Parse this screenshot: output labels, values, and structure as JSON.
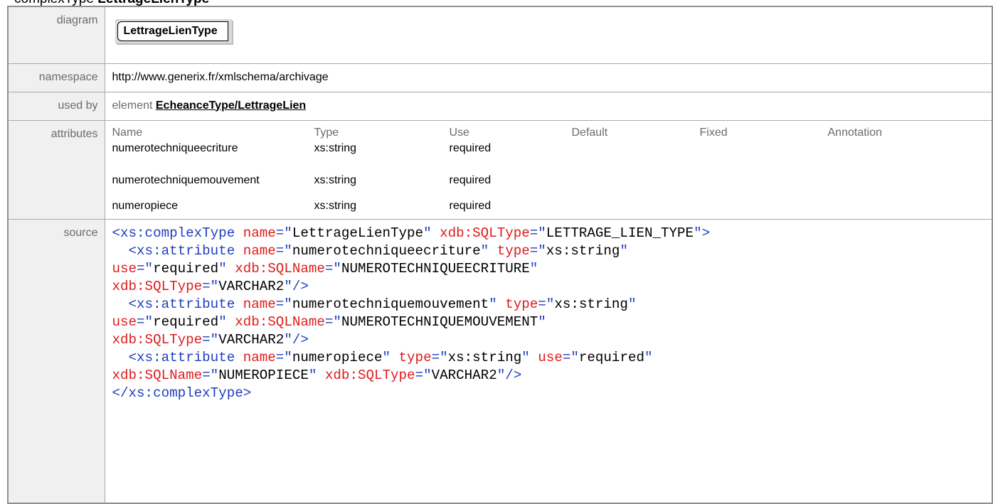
{
  "heading": {
    "kind": "complexType",
    "name": "LettrageLienType"
  },
  "diagram": {
    "label": "diagram",
    "box_text": "LettrageLienType"
  },
  "namespace": {
    "label": "namespace",
    "value": "http://www.generix.fr/xmlschema/archivage"
  },
  "used_by": {
    "label": "used by",
    "kind": "element",
    "link": "EcheanceType/LettrageLien"
  },
  "attributes": {
    "label": "attributes",
    "headers": [
      "Name",
      "Type",
      "Use",
      "Default",
      "Fixed",
      "Annotation"
    ],
    "rows": [
      {
        "name": "numerotechniqueecriture",
        "type": "xs:string",
        "use": "required"
      },
      {
        "name": "numerotechniquemouvement",
        "type": "xs:string",
        "use": "required"
      },
      {
        "name": "numeropiece",
        "type": "xs:string",
        "use": "required"
      }
    ]
  },
  "source": {
    "label": "source",
    "lines": [
      [
        [
          "k",
          "<xs:complexType"
        ],
        [
          "t",
          " "
        ],
        [
          "a",
          "name"
        ],
        [
          "k",
          "=\""
        ],
        [
          "t",
          "LettrageLienType"
        ],
        [
          "k",
          "\""
        ],
        [
          "t",
          " "
        ],
        [
          "a",
          "xdb:SQLType"
        ],
        [
          "k",
          "=\""
        ],
        [
          "t",
          "LETTRAGE_LIEN_TYPE"
        ],
        [
          "k",
          "\">"
        ]
      ],
      [
        [
          "t",
          "  "
        ],
        [
          "k",
          "<xs:attribute"
        ],
        [
          "t",
          " "
        ],
        [
          "a",
          "name"
        ],
        [
          "k",
          "=\""
        ],
        [
          "t",
          "numerotechniqueecriture"
        ],
        [
          "k",
          "\""
        ],
        [
          "t",
          " "
        ],
        [
          "a",
          "type"
        ],
        [
          "k",
          "=\""
        ],
        [
          "t",
          "xs:string"
        ],
        [
          "k",
          "\""
        ]
      ],
      [
        [
          "a",
          "use"
        ],
        [
          "k",
          "=\""
        ],
        [
          "t",
          "required"
        ],
        [
          "k",
          "\""
        ],
        [
          "t",
          " "
        ],
        [
          "a",
          "xdb:SQLName"
        ],
        [
          "k",
          "=\""
        ],
        [
          "t",
          "NUMEROTECHNIQUEECRITURE"
        ],
        [
          "k",
          "\""
        ]
      ],
      [
        [
          "a",
          "xdb:SQLType"
        ],
        [
          "k",
          "=\""
        ],
        [
          "t",
          "VARCHAR2"
        ],
        [
          "k",
          "\"/>"
        ]
      ],
      [
        [
          "t",
          "  "
        ],
        [
          "k",
          "<xs:attribute"
        ],
        [
          "t",
          " "
        ],
        [
          "a",
          "name"
        ],
        [
          "k",
          "=\""
        ],
        [
          "t",
          "numerotechniquemouvement"
        ],
        [
          "k",
          "\""
        ],
        [
          "t",
          " "
        ],
        [
          "a",
          "type"
        ],
        [
          "k",
          "=\""
        ],
        [
          "t",
          "xs:string"
        ],
        [
          "k",
          "\""
        ]
      ],
      [
        [
          "a",
          "use"
        ],
        [
          "k",
          "=\""
        ],
        [
          "t",
          "required"
        ],
        [
          "k",
          "\""
        ],
        [
          "t",
          " "
        ],
        [
          "a",
          "xdb:SQLName"
        ],
        [
          "k",
          "=\""
        ],
        [
          "t",
          "NUMEROTECHNIQUEMOUVEMENT"
        ],
        [
          "k",
          "\""
        ]
      ],
      [
        [
          "a",
          "xdb:SQLType"
        ],
        [
          "k",
          "=\""
        ],
        [
          "t",
          "VARCHAR2"
        ],
        [
          "k",
          "\"/>"
        ]
      ],
      [
        [
          "t",
          "  "
        ],
        [
          "k",
          "<xs:attribute"
        ],
        [
          "t",
          " "
        ],
        [
          "a",
          "name"
        ],
        [
          "k",
          "=\""
        ],
        [
          "t",
          "numeropiece"
        ],
        [
          "k",
          "\""
        ],
        [
          "t",
          " "
        ],
        [
          "a",
          "type"
        ],
        [
          "k",
          "=\""
        ],
        [
          "t",
          "xs:string"
        ],
        [
          "k",
          "\""
        ],
        [
          "t",
          " "
        ],
        [
          "a",
          "use"
        ],
        [
          "k",
          "=\""
        ],
        [
          "t",
          "required"
        ],
        [
          "k",
          "\""
        ]
      ],
      [
        [
          "a",
          "xdb:SQLName"
        ],
        [
          "k",
          "=\""
        ],
        [
          "t",
          "NUMEROPIECE"
        ],
        [
          "k",
          "\""
        ],
        [
          "t",
          " "
        ],
        [
          "a",
          "xdb:SQLType"
        ],
        [
          "k",
          "=\""
        ],
        [
          "t",
          "VARCHAR2"
        ],
        [
          "k",
          "\"/>"
        ]
      ],
      [
        [
          "k",
          "</xs:complexType>"
        ]
      ]
    ]
  },
  "colors": {
    "tag": "#1f3fbf",
    "attribute": "#e01b1b",
    "label_bg": "#f0f0f0",
    "label_text": "#6b6b6b"
  }
}
